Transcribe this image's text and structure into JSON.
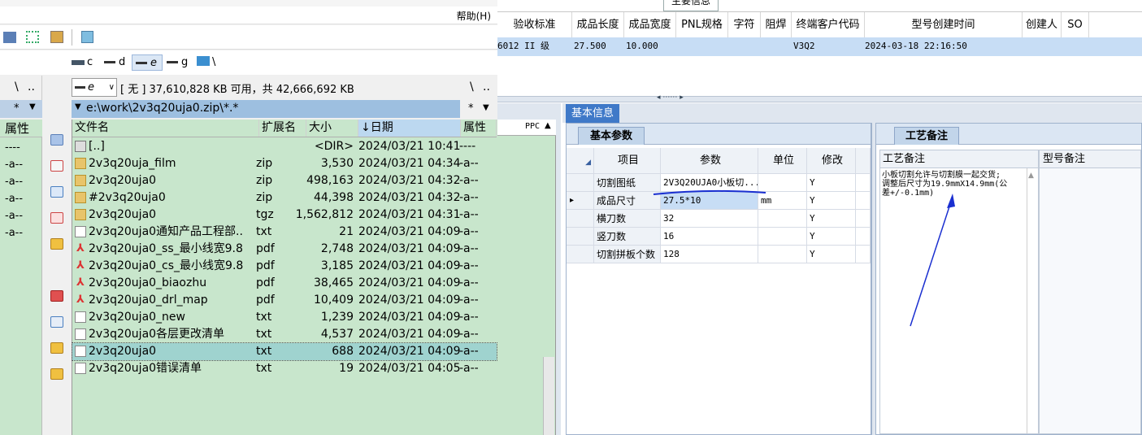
{
  "fm": {
    "menu_help": "帮助(H)",
    "drives": {
      "c": "c",
      "d": "d",
      "e": "e",
      "g": "g",
      "net": "\\"
    },
    "left_nav": {
      "root": "\\",
      "up": "..",
      "filter": "*"
    },
    "drive_combo": "e",
    "free_space": "[ 无 ]  37,610,828 KB 可用，共 42,666,692 KB",
    "right_nav": {
      "root": "\\",
      "up": ".."
    },
    "path": "e:\\work\\2v3q20uja0.zip\\*.*",
    "filter": "*",
    "left_header_attr": "属性",
    "left_attr_values": [
      "----",
      "-a--",
      "-a--",
      "-a--",
      "-a--",
      "-a--"
    ],
    "columns": {
      "name": "文件名",
      "ext": "扩展名",
      "size": "大小",
      "date": "↓日期",
      "attr": "属性"
    },
    "files": [
      {
        "icon": "up-dir-icon",
        "name": "[..]",
        "ext": "",
        "size": "<DIR>",
        "date": "2024/03/21 10:41",
        "attr": "----"
      },
      {
        "icon": "zip-icon",
        "name": "2v3q20uja_film",
        "ext": "zip",
        "size": "3,530",
        "date": "2024/03/21 04:34",
        "attr": "-a--"
      },
      {
        "icon": "zip-icon",
        "name": "2v3q20uja0",
        "ext": "zip",
        "size": "498,163",
        "date": "2024/03/21 04:32",
        "attr": "-a--"
      },
      {
        "icon": "zip-icon",
        "name": "#2v3q20uja0",
        "ext": "zip",
        "size": "44,398",
        "date": "2024/03/21 04:32",
        "attr": "-a--"
      },
      {
        "icon": "zip-icon",
        "name": "2v3q20uja0",
        "ext": "tgz",
        "size": "1,562,812",
        "date": "2024/03/21 04:31",
        "attr": "-a--"
      },
      {
        "icon": "txt-icon",
        "name": "2v3q20uja0通知产品工程部..",
        "ext": "txt",
        "size": "21",
        "date": "2024/03/21 04:09",
        "attr": "-a--"
      },
      {
        "icon": "pdf-icon",
        "name": "2v3q20uja0_ss_最小线宽9.8",
        "ext": "pdf",
        "size": "2,748",
        "date": "2024/03/21 04:09",
        "attr": "-a--"
      },
      {
        "icon": "pdf-icon",
        "name": "2v3q20uja0_cs_最小线宽9.8",
        "ext": "pdf",
        "size": "3,185",
        "date": "2024/03/21 04:09",
        "attr": "-a--"
      },
      {
        "icon": "pdf-icon",
        "name": "2v3q20uja0_biaozhu",
        "ext": "pdf",
        "size": "38,465",
        "date": "2024/03/21 04:09",
        "attr": "-a--"
      },
      {
        "icon": "pdf-icon",
        "name": "2v3q20uja0_drl_map",
        "ext": "pdf",
        "size": "10,409",
        "date": "2024/03/21 04:09",
        "attr": "-a--"
      },
      {
        "icon": "txt-icon",
        "name": "2v3q20uja0_new",
        "ext": "txt",
        "size": "1,239",
        "date": "2024/03/21 04:09",
        "attr": "-a--"
      },
      {
        "icon": "txt-icon",
        "name": "2v3q20uja0各层更改清单",
        "ext": "txt",
        "size": "4,537",
        "date": "2024/03/21 04:09",
        "attr": "-a--"
      },
      {
        "icon": "txt-icon",
        "name": "2v3q20uja0",
        "ext": "txt",
        "size": "688",
        "date": "2024/03/21 04:09",
        "attr": "-a--",
        "selected": true
      },
      {
        "icon": "txt-icon",
        "name": "2v3q20uja0错误清单",
        "ext": "txt",
        "size": "19",
        "date": "2024/03/21 04:05",
        "attr": "-a--"
      }
    ]
  },
  "erp": {
    "top_tab": "主要信息",
    "columns": [
      "验收标准",
      "成品长度",
      "成品宽度",
      "PNL规格",
      "字符",
      "阻焊",
      "终端客户代码",
      "型号创建时间",
      "创建人",
      "SO"
    ],
    "row": {
      "acceptance": "6012 II 级",
      "length": "27.500",
      "width": "10.000",
      "pnl": "",
      "char": "",
      "mask": "",
      "customer_code": "V3Q2",
      "created": "2024-03-18 22:16:50",
      "creator": "",
      "so": ""
    },
    "left_strip_label": "PPC",
    "section_tab": "基本信息",
    "params_tab": "基本参数",
    "params_headers": {
      "item": "项目",
      "value": "参数",
      "unit": "单位",
      "modify": "修改"
    },
    "params": [
      {
        "item": "切割图纸",
        "value": "2V3Q20UJA0小板切...",
        "unit": "",
        "modify": "Y"
      },
      {
        "item": "成品尺寸",
        "value": "27.5*10",
        "unit": "mm",
        "modify": "Y"
      },
      {
        "item": "横刀数",
        "value": "32",
        "unit": "",
        "modify": "Y"
      },
      {
        "item": "竖刀数",
        "value": "16",
        "unit": "",
        "modify": "Y"
      },
      {
        "item": "切割拼板个数",
        "value": "128",
        "unit": "",
        "modify": "Y"
      }
    ],
    "process_tab": "工艺备注",
    "process_note_header": "工艺备注",
    "model_note_header": "型号备注",
    "process_note": "小板切割允许与切割膜一起交货;\n调整后尺寸为19.9mmX14.9mm(公\n差+/-0.1mm)"
  },
  "colors": {
    "green": "#c8e6cc",
    "selected": "#9fd3cf",
    "header_blue": "#bcd8f0",
    "tab_blue": "#3f79c8",
    "row_blue": "#c7ddf5",
    "annotation": "#1a2fd0"
  }
}
